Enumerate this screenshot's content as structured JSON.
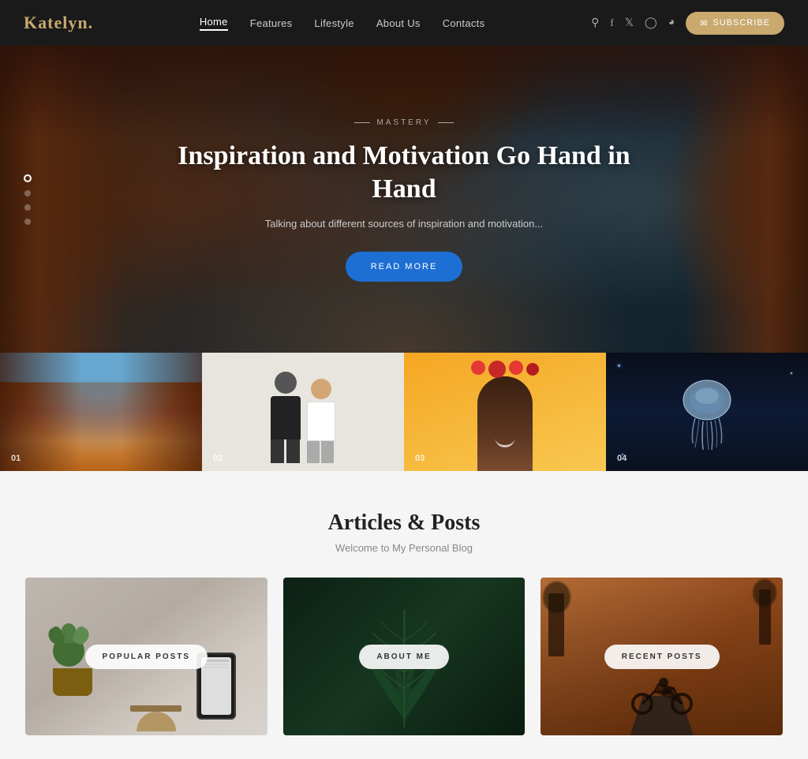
{
  "header": {
    "logo_text": "Katelyn",
    "logo_dot": ".",
    "nav_items": [
      {
        "label": "Home",
        "active": true
      },
      {
        "label": "Features",
        "active": false
      },
      {
        "label": "Lifestyle",
        "active": false
      },
      {
        "label": "About Us",
        "active": false
      },
      {
        "label": "Contacts",
        "active": false
      }
    ],
    "subscribe_label": "SUBSCRIBE"
  },
  "hero": {
    "category": "MASTERY",
    "title": "Inspiration and Motivation Go Hand in Hand",
    "subtitle": "Talking about different sources of inspiration and motivation...",
    "cta_label": "READ MORE",
    "slider_dots": [
      {
        "active": true
      },
      {
        "active": false
      },
      {
        "active": false
      },
      {
        "active": false
      }
    ]
  },
  "gallery": {
    "items": [
      {
        "num": "01"
      },
      {
        "num": "02"
      },
      {
        "num": "03"
      },
      {
        "num": "04"
      }
    ]
  },
  "articles": {
    "title": "Articles & Posts",
    "subtitle": "Welcome to My Personal Blog",
    "cards": [
      {
        "label": "POPULAR POSTS"
      },
      {
        "label": "ABOUT ME"
      },
      {
        "label": "RECENT POSTS"
      }
    ]
  }
}
